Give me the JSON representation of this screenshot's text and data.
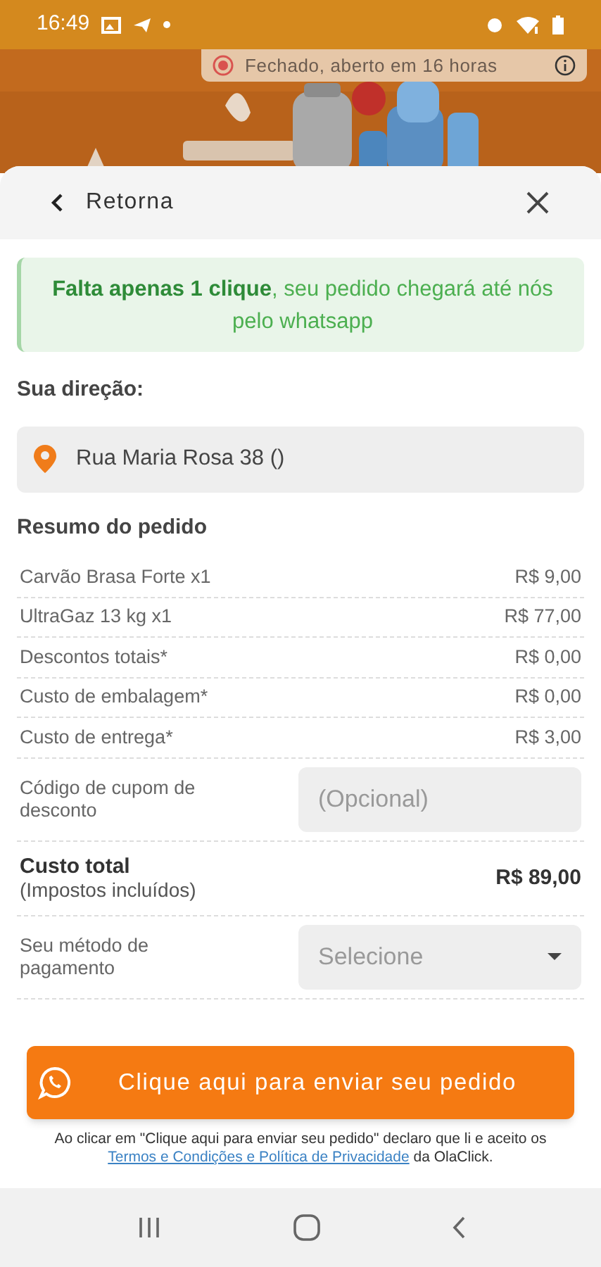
{
  "status_bar": {
    "time": "16:49"
  },
  "store_status": {
    "text": "Fechado, aberto em 16 horas",
    "open": false
  },
  "header": {
    "back_label": "Retorna"
  },
  "notice": "**Falta apenas 1 clique**, seu pedido chegará até nós pelo whatsapp",
  "address": {
    "label": "Sua direção:",
    "value": "Rua Maria Rosa 38 ()"
  },
  "summary": {
    "title": "Resumo do pedido",
    "rows": [
      {
        "label": "Carvão Brasa Forte x1",
        "amount": "R$ 9,00"
      },
      {
        "label": "UltraGaz 13 kg x1",
        "amount": "R$ 77,00"
      },
      {
        "label": "Descontos totais*",
        "amount": "R$ 0,00"
      },
      {
        "label": "Custo de embalagem*",
        "amount": "R$ 0,00"
      },
      {
        "label": "Custo de entrega*",
        "amount": "R$ 3,00"
      }
    ],
    "coupon": {
      "label": "Código de cupom de desconto",
      "placeholder": "(Opcional)"
    },
    "total": {
      "label": "Custo total",
      "note": "(Impostos incluídos)",
      "amount": "R$ 89,00"
    },
    "payment": {
      "label": "Seu método de pagamento",
      "placeholder": "Selecione"
    }
  },
  "send_button": "Clique aqui para enviar seu pedido",
  "footer": {
    "before": "Ao clicar em \"Clique aqui para enviar seu pedido\" declaro que li e aceito os",
    "link": "Termos e Condições e Política de Privacidade",
    "after": "da OlaClick."
  }
}
